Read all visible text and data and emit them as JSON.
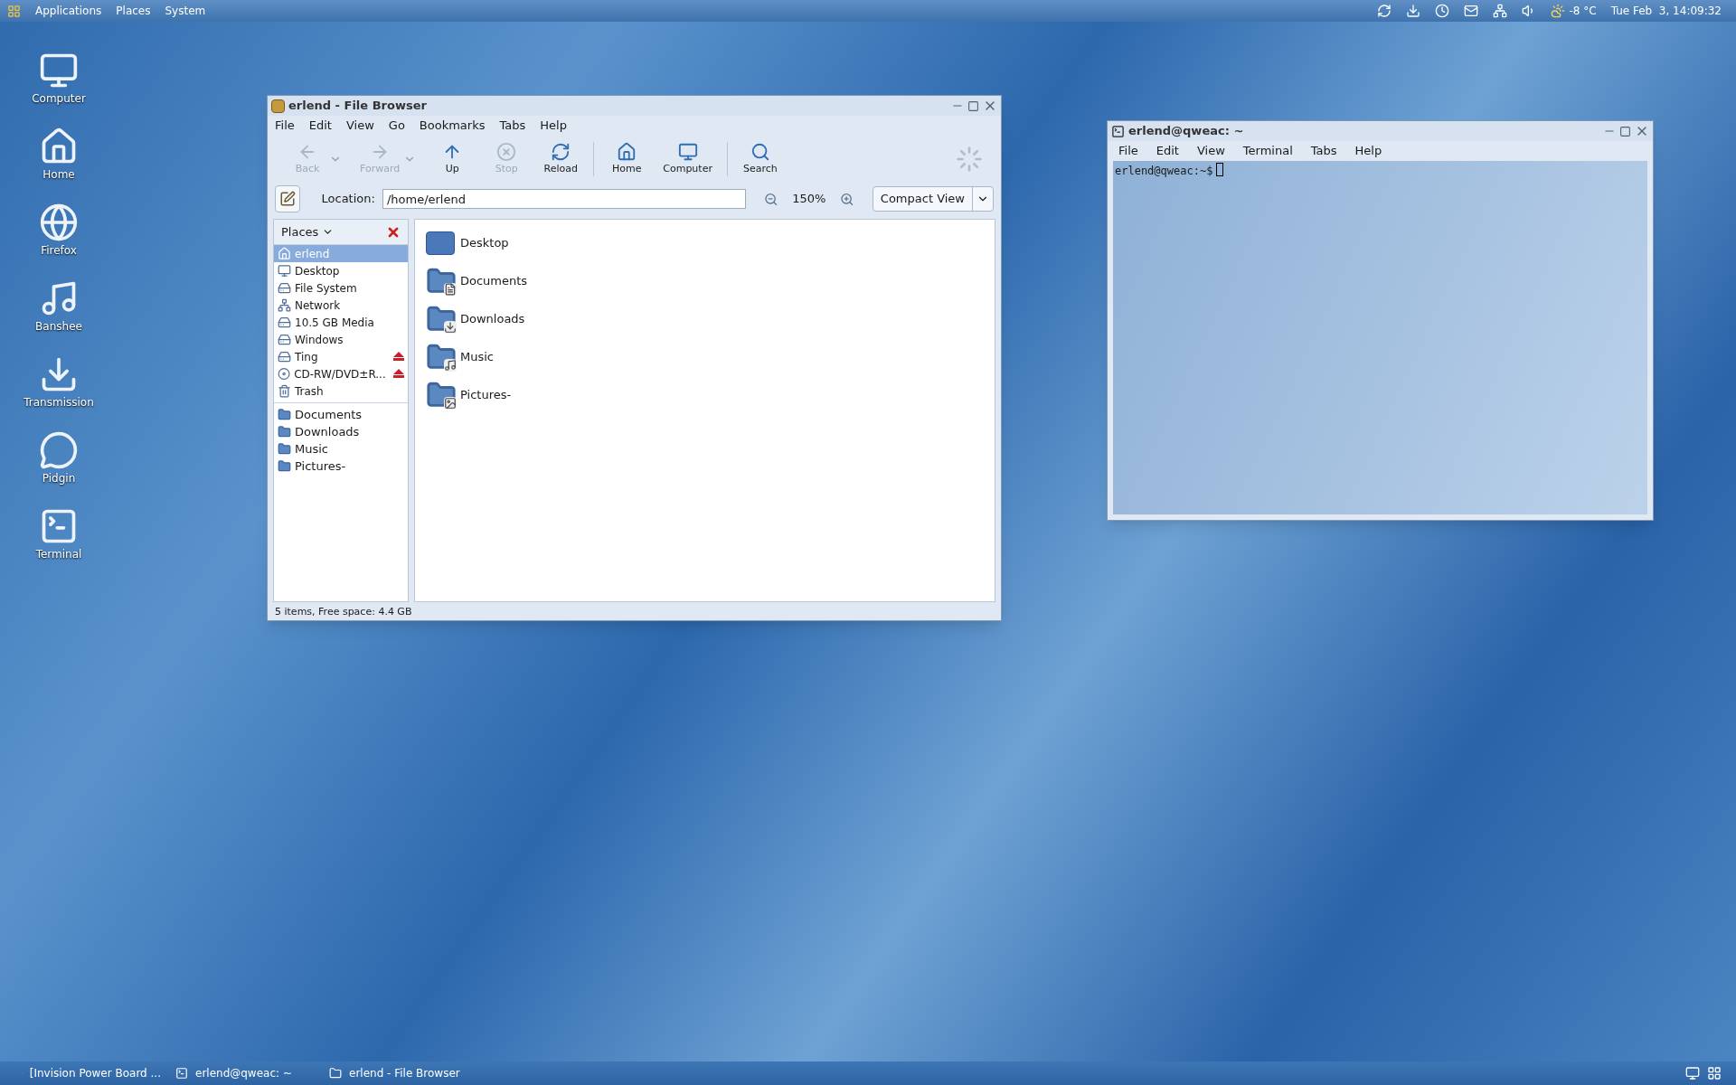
{
  "top_panel": {
    "menus": [
      "Applications",
      "Places",
      "System"
    ],
    "weather": "-8 °C",
    "clock": "Tue Feb  3, 14:09:32"
  },
  "desktop_icons": [
    {
      "kind": "computer",
      "label": "Computer"
    },
    {
      "kind": "home",
      "label": "Home"
    },
    {
      "kind": "browser",
      "label": "Firefox"
    },
    {
      "kind": "music",
      "label": "Banshee"
    },
    {
      "kind": "download",
      "label": "Transmission"
    },
    {
      "kind": "chat",
      "label": "Pidgin"
    },
    {
      "kind": "terminal",
      "label": "Terminal"
    }
  ],
  "file_browser": {
    "title": "erlend - File Browser",
    "menu": [
      "File",
      "Edit",
      "View",
      "Go",
      "Bookmarks",
      "Tabs",
      "Help"
    ],
    "toolbar": [
      [
        {
          "kind": "back",
          "label": "Back",
          "disabled": true,
          "dropdown": true
        },
        {
          "kind": "forward",
          "label": "Forward",
          "disabled": true,
          "dropdown": true
        },
        {
          "kind": "up",
          "label": "Up",
          "disabled": false,
          "dropdown": false
        },
        {
          "kind": "stop",
          "label": "Stop",
          "disabled": true,
          "dropdown": false
        },
        {
          "kind": "reload",
          "label": "Reload",
          "disabled": false,
          "dropdown": false
        }
      ],
      [
        {
          "kind": "home",
          "label": "Home",
          "disabled": false,
          "dropdown": false
        },
        {
          "kind": "computer",
          "label": "Computer",
          "disabled": false,
          "dropdown": false
        }
      ],
      [
        {
          "kind": "search",
          "label": "Search",
          "disabled": false,
          "dropdown": false
        }
      ]
    ],
    "location_label": "Location:",
    "location": "/home/erlend",
    "zoom": "150%",
    "view": "Compact View",
    "sidebar_title": "Places",
    "places": [
      {
        "kind": "home",
        "label": "erlend",
        "selected": true,
        "eject": false
      },
      {
        "kind": "desktop",
        "label": "Desktop",
        "selected": false,
        "eject": false
      },
      {
        "kind": "drive",
        "label": "File System",
        "selected": false,
        "eject": false
      },
      {
        "kind": "network",
        "label": "Network",
        "selected": false,
        "eject": false
      },
      {
        "kind": "drive",
        "label": "10.5 GB Media",
        "selected": false,
        "eject": false
      },
      {
        "kind": "drive",
        "label": "Windows",
        "selected": false,
        "eject": false
      },
      {
        "kind": "drive",
        "label": "Ting",
        "selected": false,
        "eject": true
      },
      {
        "kind": "disc",
        "label": "CD-RW/DVD±R...",
        "selected": false,
        "eject": true
      },
      {
        "kind": "trash",
        "label": "Trash",
        "selected": false,
        "eject": false
      }
    ],
    "bookmarks": [
      "Documents",
      "Downloads",
      "Music",
      "Pictures-"
    ],
    "files": [
      {
        "kind": "desktop",
        "label": "Desktop"
      },
      {
        "kind": "documents",
        "label": "Documents"
      },
      {
        "kind": "downloads",
        "label": "Downloads"
      },
      {
        "kind": "music",
        "label": "Music"
      },
      {
        "kind": "pictures",
        "label": "Pictures-"
      }
    ],
    "status": "5 items, Free space: 4.4 GB"
  },
  "terminal": {
    "title": "erlend@qweac: ~",
    "menu": [
      "File",
      "Edit",
      "View",
      "Terminal",
      "Tabs",
      "Help"
    ],
    "prompt": "erlend@qweac:~$"
  },
  "taskbar": [
    {
      "kind": "browser",
      "label": "[Invision Power Board ..."
    },
    {
      "kind": "terminal",
      "label": "erlend@qweac: ~"
    },
    {
      "kind": "files",
      "label": "erlend - File Browser"
    }
  ]
}
